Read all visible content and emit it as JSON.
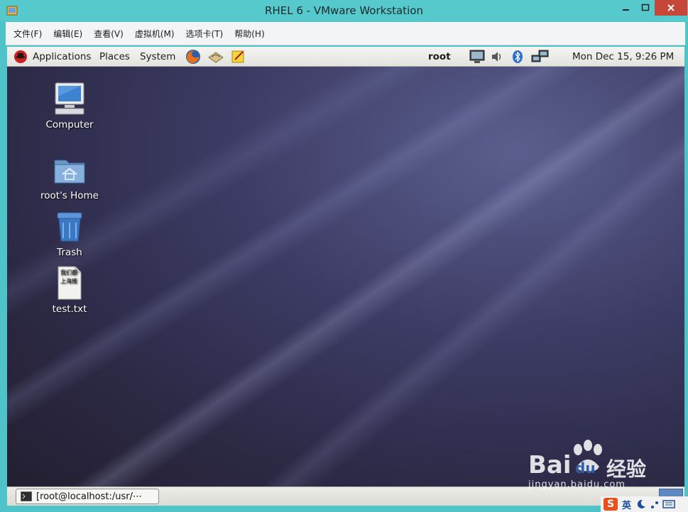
{
  "window": {
    "title": "RHEL 6 - VMware Workstation"
  },
  "menu": {
    "items": [
      {
        "label": "文件(F)"
      },
      {
        "label": "编辑(E)"
      },
      {
        "label": "查看(V)"
      },
      {
        "label": "虚拟机(M)"
      },
      {
        "label": "选项卡(T)"
      },
      {
        "label": "帮助(H)"
      }
    ]
  },
  "panel": {
    "applications": "Applications",
    "places": "Places",
    "system": "System",
    "user": "root",
    "clock": "Mon Dec 15,  9:26 PM"
  },
  "desktop_icons": [
    {
      "label": "Computer",
      "icon": "computer-icon"
    },
    {
      "label": "root's Home",
      "icon": "home-folder-icon"
    },
    {
      "label": "Trash",
      "icon": "trash-icon"
    },
    {
      "label": "test.txt",
      "icon": "text-file-icon",
      "preview_lines": [
        "我们都",
        "上海推"
      ]
    }
  ],
  "taskbar": {
    "window_button": "[root@localhost:/usr/⋯"
  },
  "watermark": {
    "brand_latin": "Bai",
    "brand_du": "du",
    "brand_cn": "经验",
    "url": "jingyan.baidu.com"
  },
  "ime": {
    "mode": "英"
  },
  "colors": {
    "host_frame": "#56c9cc",
    "close_button": "#c7463a",
    "desktop_base": "#3a3558"
  }
}
